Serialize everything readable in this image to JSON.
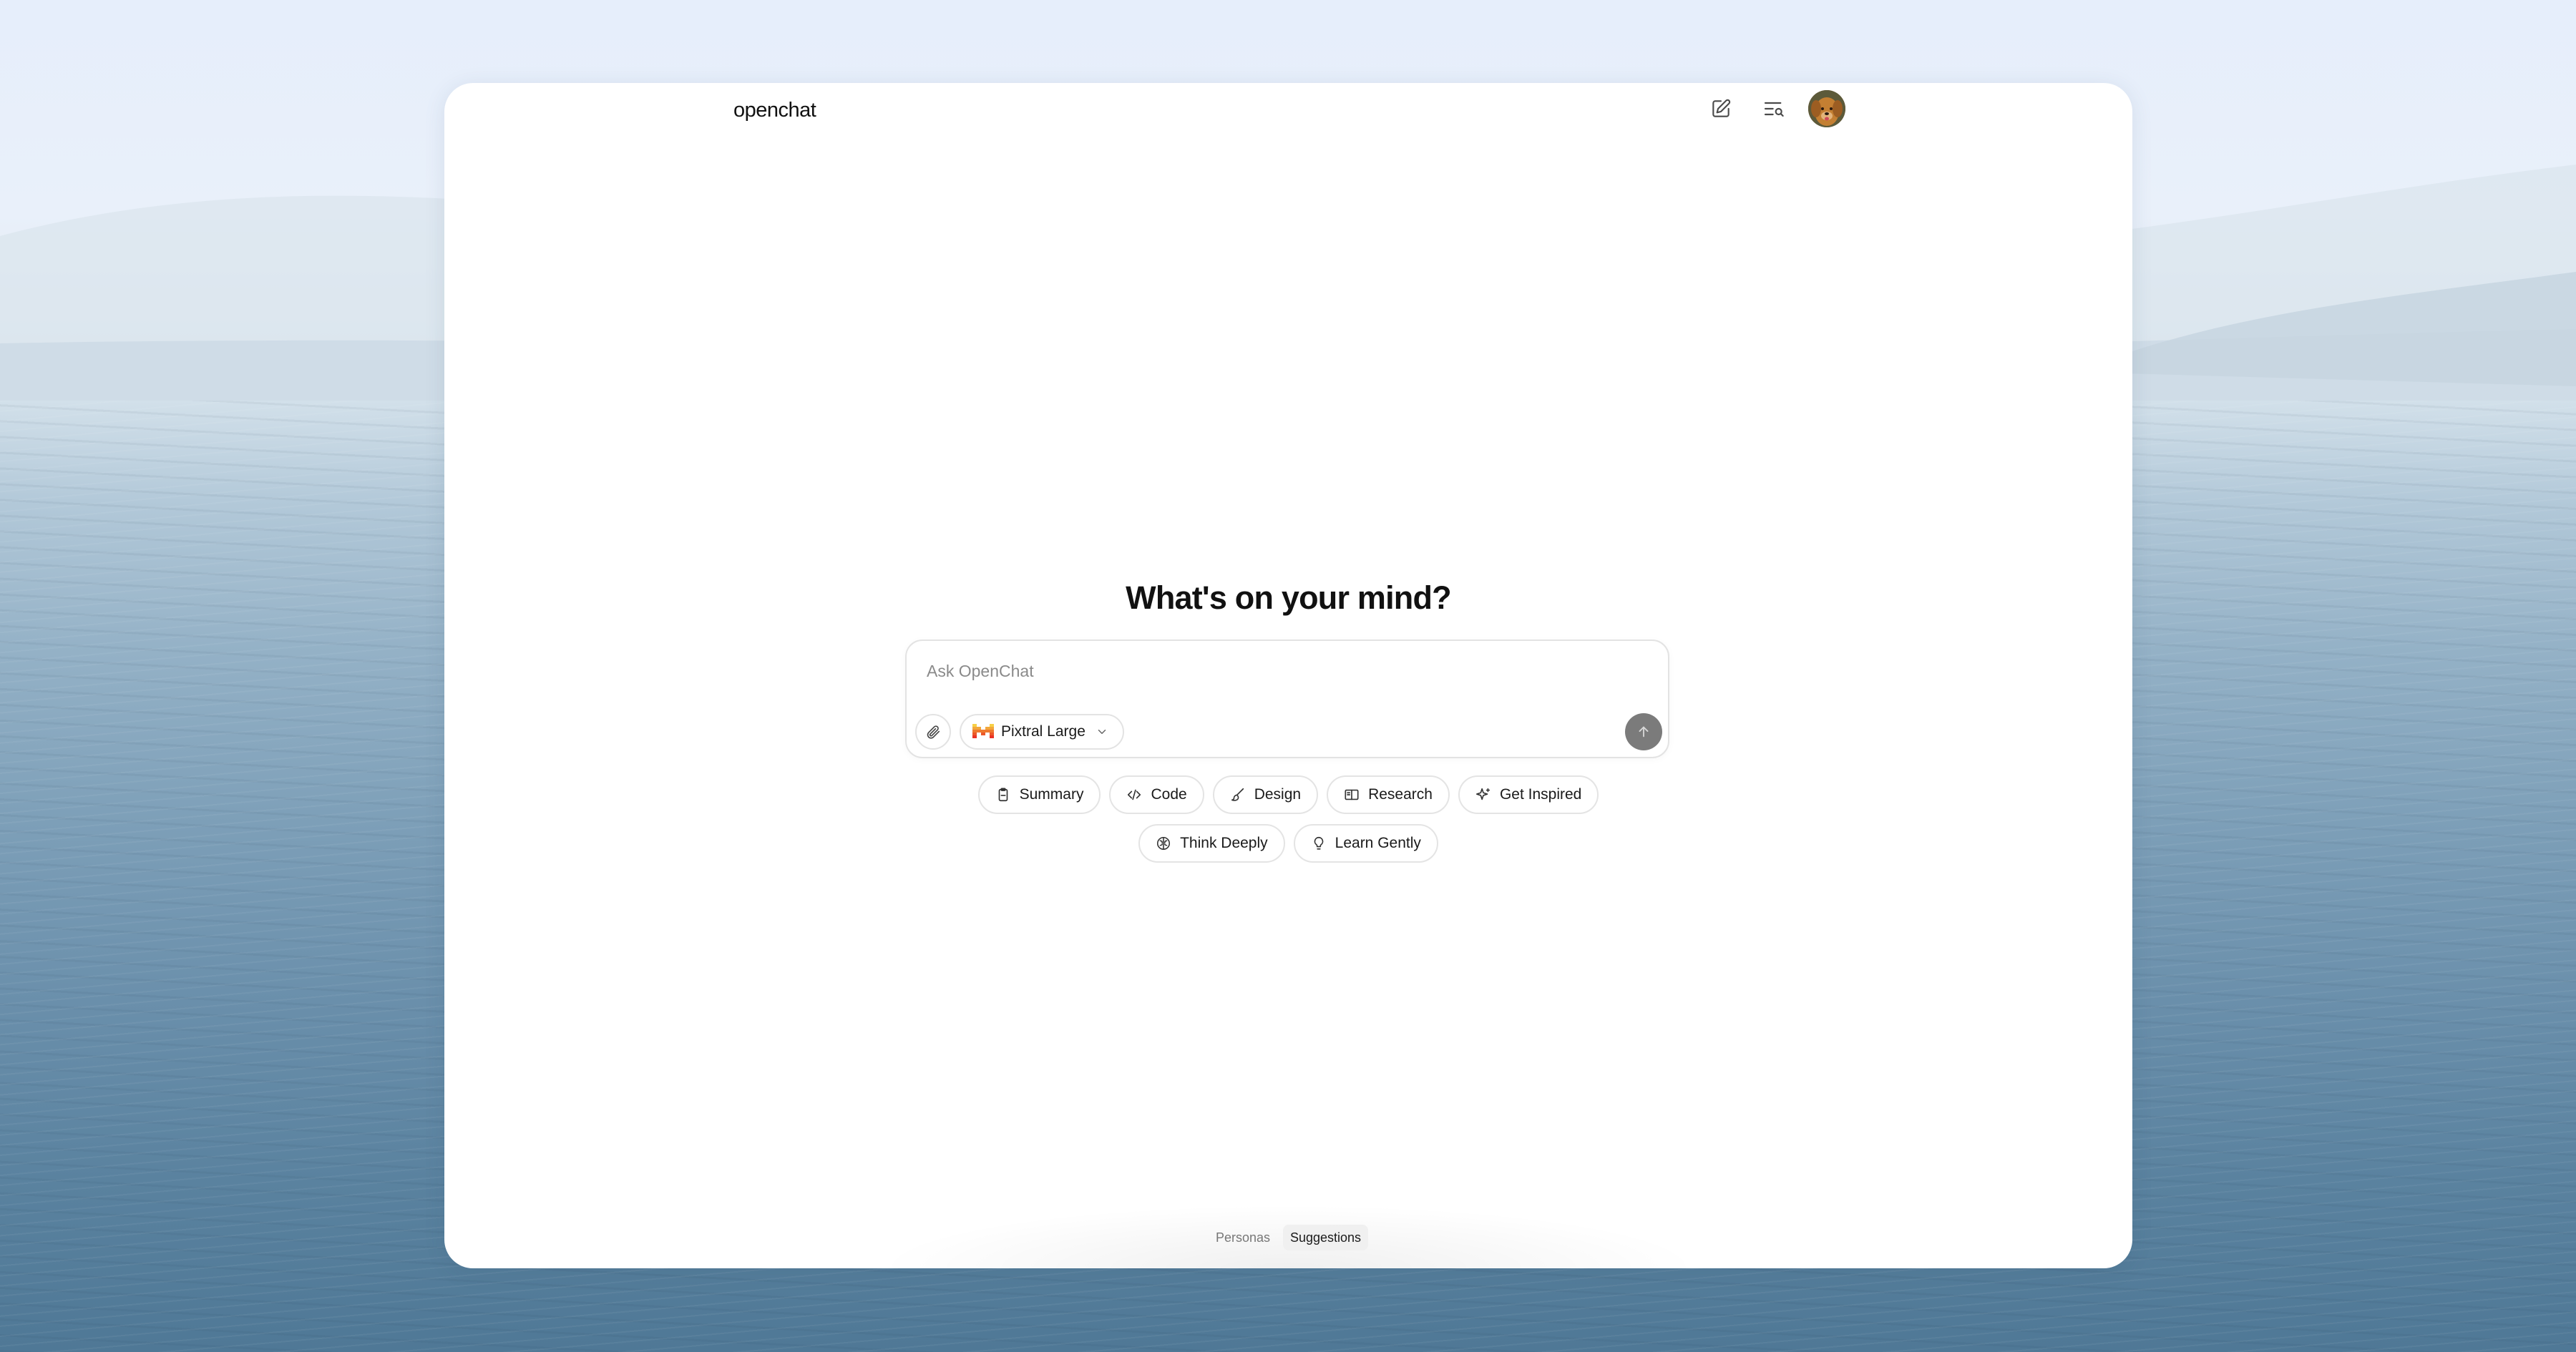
{
  "app": {
    "logo": "openchat"
  },
  "header": {
    "new_chat_icon": "edit-square-icon",
    "history_icon": "search-history-icon",
    "avatar_icon": "user-avatar"
  },
  "main": {
    "headline": "What's on your mind?",
    "composer": {
      "placeholder": "Ask OpenChat",
      "value": "",
      "model": "Pixtral Large",
      "attach_icon": "paperclip-icon",
      "send_icon": "arrow-up-icon"
    },
    "suggestions_row1": [
      {
        "label": "Summary",
        "icon": "clipboard-icon"
      },
      {
        "label": "Code",
        "icon": "code-icon"
      },
      {
        "label": "Design",
        "icon": "brush-icon"
      },
      {
        "label": "Research",
        "icon": "book-open-icon"
      },
      {
        "label": "Get Inspired",
        "icon": "sparkle-icon"
      }
    ],
    "suggestions_row2": [
      {
        "label": "Think Deeply",
        "icon": "brain-icon"
      },
      {
        "label": "Learn Gently",
        "icon": "lightbulb-icon"
      }
    ]
  },
  "footer": {
    "tabs": [
      {
        "label": "Personas",
        "active": false
      },
      {
        "label": "Suggestions",
        "active": true
      }
    ]
  },
  "colors": {
    "accent_send": "#7b7b7b",
    "border": "#e3e3e3",
    "text": "#111111"
  }
}
